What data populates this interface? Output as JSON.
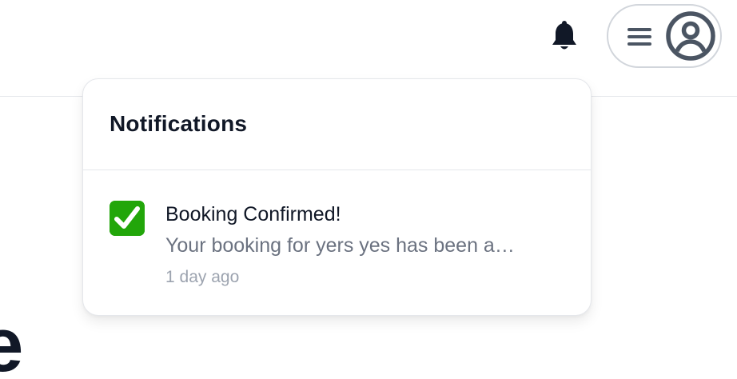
{
  "header": {
    "bell_icon": "bell-icon",
    "menu_icon": "hamburger-menu-icon",
    "avatar_icon": "user-circle-icon"
  },
  "notifications": {
    "title": "Notifications",
    "items": [
      {
        "icon": "check-mark-emoji",
        "title": "Booking Confirmed!",
        "body": "Your booking for yers yes has been a…",
        "time": "1 day ago"
      }
    ]
  },
  "background": {
    "partial_text": "e"
  },
  "colors": {
    "text_primary": "#111827",
    "text_secondary": "#6b7280",
    "text_muted": "#9ca3af",
    "border": "#e5e7eb",
    "check_green": "#22a60a",
    "icon_gray": "#4b5563"
  }
}
